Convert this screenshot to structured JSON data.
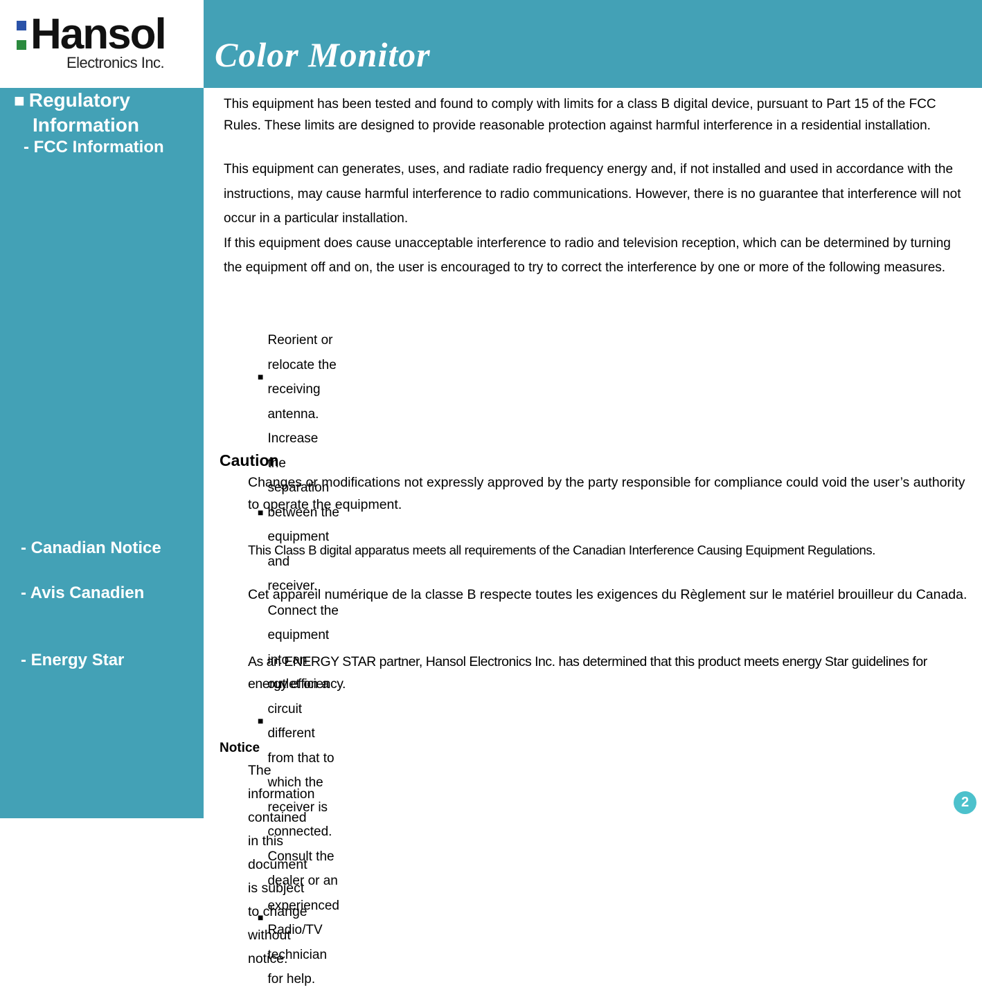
{
  "header": {
    "logo": {
      "brand": "Hansol",
      "subtitle": "Electronics Inc.",
      "colors": {
        "dot_top": "#2a52a8",
        "dot_bottom": "#2b8a3e"
      }
    },
    "title": "Color Monitor",
    "band_color": "#43a1b6"
  },
  "sidebar": {
    "section_bullet": "■",
    "section_title_line1": "Regulatory",
    "section_title_line2": "Information",
    "items": [
      {
        "label": "- FCC Information"
      },
      {
        "label": "- Canadian Notice"
      },
      {
        "label": "- Avis Canadien"
      },
      {
        "label": "- Energy Star"
      }
    ]
  },
  "fcc": {
    "paragraph1": "This equipment has been tested and found to comply with limits for a class B digital device, pursuant to Part 15 of the FCC Rules. These limits are designed to provide reasonable protection against harmful interference in a residential installation.",
    "paragraph2": "This equipment can generates, uses, and radiate radio frequency energy and, if not installed and used in accordance with the instructions, may cause harmful interference to radio communications. However, there is no guarantee that interference will not occur in a particular installation.",
    "paragraph3": "If this equipment does cause unacceptable interference to radio and television reception, which can be determined by turning the equipment off and on, the user is encouraged to try to correct the interference by one or more of the following measures.",
    "bullet_glyph": "■",
    "measures": [
      "Reorient or relocate the receiving antenna.",
      "Increase the separation between the equipment and receiver.",
      "Connect the equipment into an outlet on a circuit different from that to which the receiver is connected.",
      "Consult the dealer or an experienced Radio/TV technician for help."
    ]
  },
  "caution": {
    "heading": "Caution",
    "text": "Changes or modifications not expressly approved by the party responsible for compliance could void the user’s authority to operate the equipment."
  },
  "canadian_notice": "This Class B digital apparatus meets all requirements of the Canadian Interference Causing Equipment Regulations.",
  "avis_canadien": "Cet appareil numérique de la classe B respecte toutes les exigences du Règlement sur le matériel brouilleur du Canada.",
  "energy_star": "As an ENERGY STAR partner, Hansol Electronics Inc. has determined that this product meets energy Star guidelines for energy efficiency.",
  "notice": {
    "heading": "Notice",
    "text": "The information contained in this document is subject to change without notice."
  },
  "page_number": "2"
}
